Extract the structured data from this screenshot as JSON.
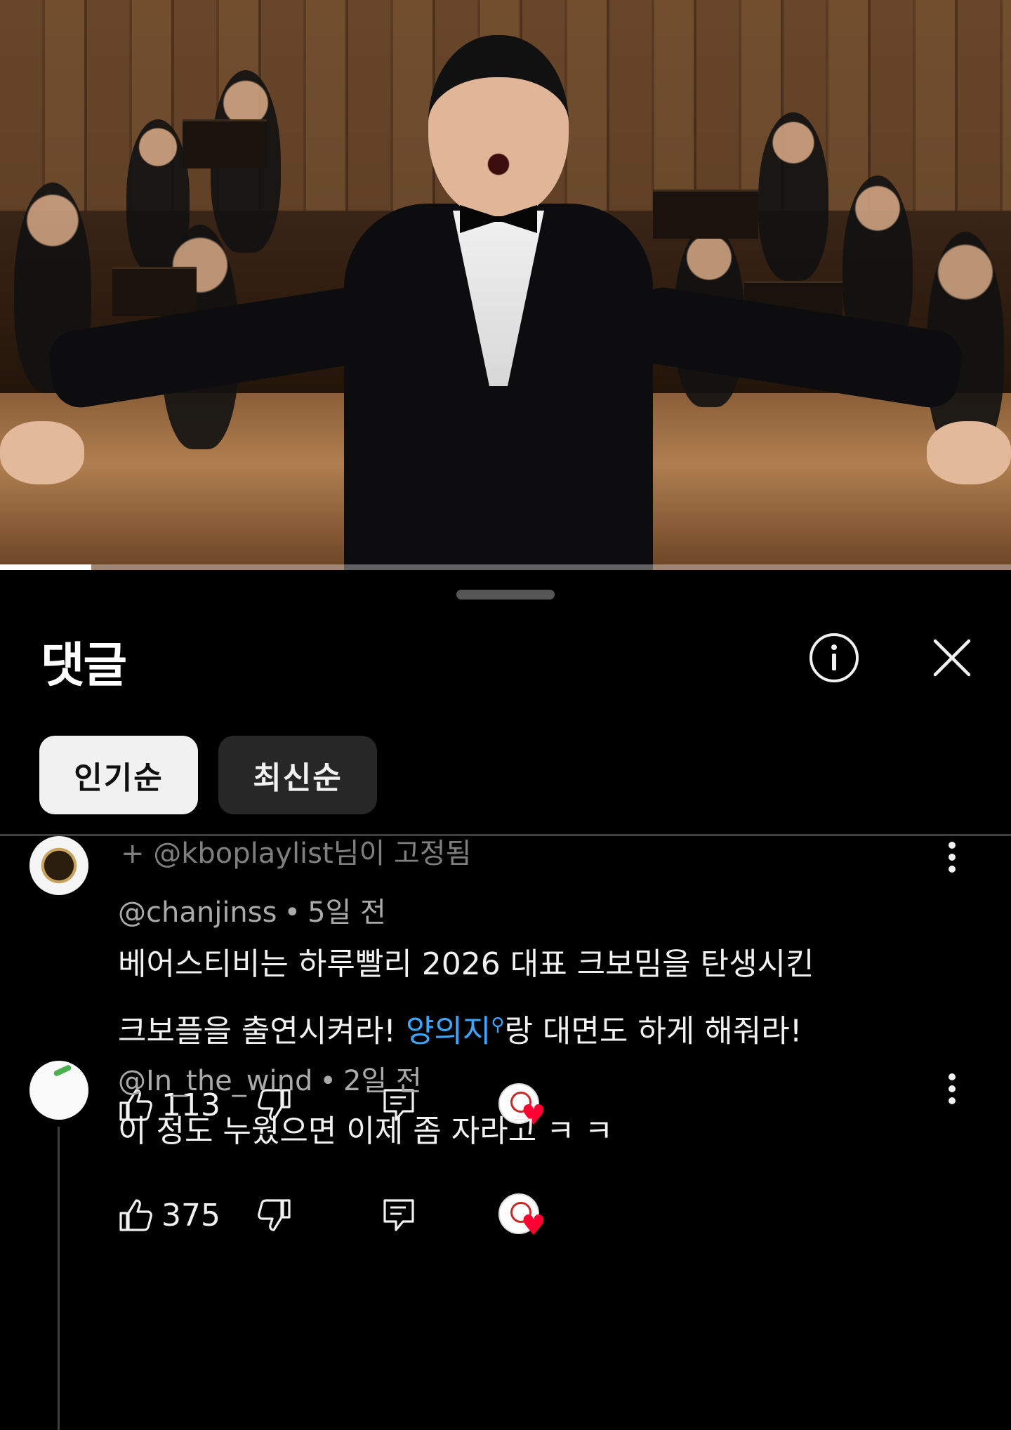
{
  "video": {
    "progress": 0.09
  },
  "sheet": {
    "title": "댓글",
    "info_icon": "info-icon",
    "close_icon": "close-icon"
  },
  "sort_chips": [
    {
      "label": "인기순",
      "active": true
    },
    {
      "label": "최신순",
      "active": false
    }
  ],
  "comments": [
    {
      "reply_context": "+ @kboplaylist님이 고정됨",
      "author": "@chanjinss",
      "time": "5일 전",
      "body_line1": "베어스티비는 하루빨리 2026 대표 크보밈을 탄생시킨",
      "body_line2_pre": "크보플을 출연시켜라! ",
      "body_link": "양의지",
      "body_line2_post": "랑 대면도 하게 해줘라!",
      "likes": "113"
    },
    {
      "author": "@In_the_wind",
      "time": "2일 전",
      "body_line1": "이 정도 누웠으면 이제 좀 자라고 ㅋ ㅋ",
      "likes": "375"
    }
  ],
  "icons": {
    "like": "thumbs-up-icon",
    "dislike": "thumbs-down-icon",
    "reply": "reply-icon",
    "creator_heart": "creator-heart-icon",
    "more": "more-vert-icon"
  },
  "colors": {
    "background": "#000000",
    "chip_active": "#f1f1f1",
    "chip_inactive": "#272727",
    "link": "#3ea6ff",
    "heart": "#ff0033"
  }
}
